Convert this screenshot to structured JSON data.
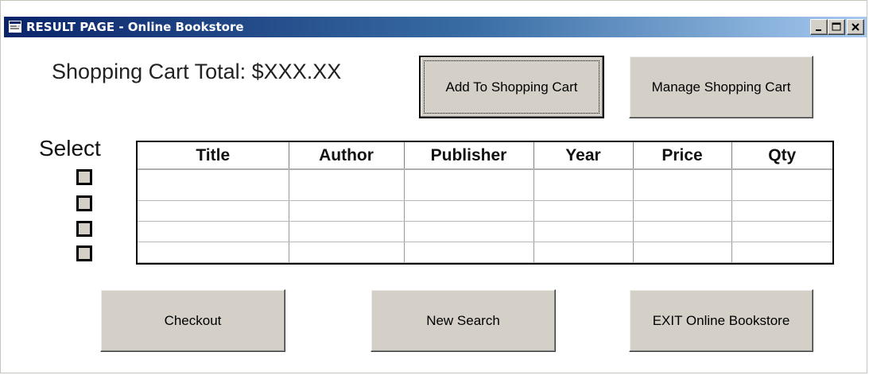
{
  "window": {
    "title": "RESULT PAGE - Online Bookstore",
    "icon": "app-window-icon",
    "controls": [
      "minimize-icon",
      "maximize-icon",
      "close-icon"
    ]
  },
  "cart": {
    "total_label": "Shopping Cart Total: $XXX.XX"
  },
  "buttons": {
    "add_to_cart": "Add To Shopping Cart",
    "manage_cart": "Manage Shopping Cart",
    "checkout": "Checkout",
    "new_search": "New Search",
    "exit": "EXIT Online Bookstore"
  },
  "select": {
    "label": "Select",
    "checkboxes": 4
  },
  "results_table": {
    "columns": [
      "Title",
      "Author",
      "Publisher",
      "Year",
      "Price",
      "Qty"
    ],
    "rows": [
      [
        "",
        "",
        "",
        "",
        "",
        ""
      ],
      [
        "",
        "",
        "",
        "",
        "",
        ""
      ],
      [
        "",
        "",
        "",
        "",
        "",
        ""
      ],
      [
        "",
        "",
        "",
        "",
        "",
        ""
      ]
    ]
  },
  "colors": {
    "titlebar_start": "#0a246a",
    "titlebar_end": "#a6caf0",
    "button_face": "#d4d0c8"
  }
}
